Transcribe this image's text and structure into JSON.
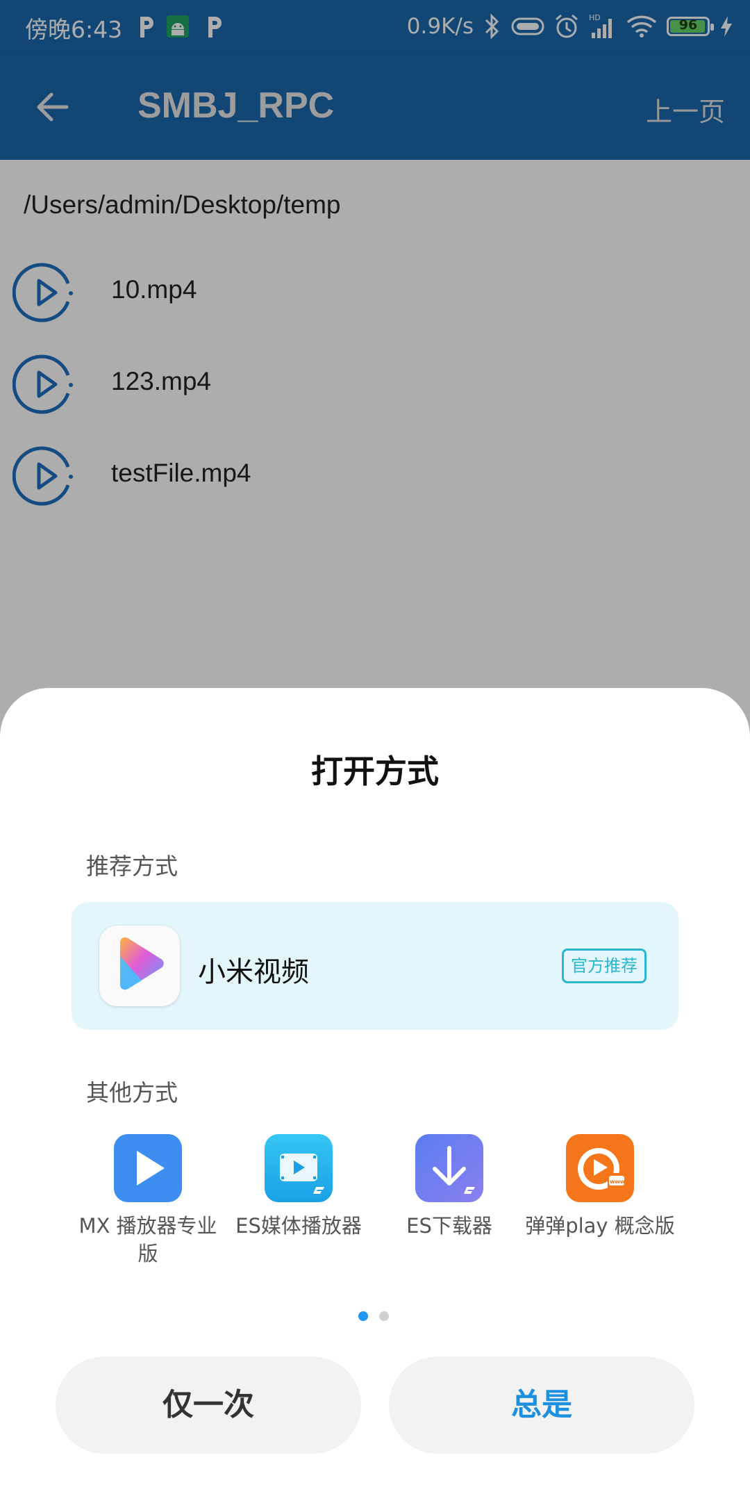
{
  "status_bar": {
    "time": "傍晚6:43",
    "net_speed": "0.9K/s",
    "signal_label": "HD",
    "battery": "96"
  },
  "app_bar": {
    "title": "SMBJ_RPC",
    "prev_page": "上一页",
    "back_icon": "arrow-left-icon"
  },
  "content": {
    "path": "/Users/admin/Desktop/temp",
    "files": [
      {
        "name": "10.mp4",
        "icon": "play-circle-icon"
      },
      {
        "name": "123.mp4",
        "icon": "play-circle-icon"
      },
      {
        "name": "testFile.mp4",
        "icon": "play-circle-icon"
      }
    ]
  },
  "sheet": {
    "title": "打开方式",
    "recommended_label": "推荐方式",
    "recommended_app": {
      "name": "小米视频",
      "badge": "官方推荐",
      "icon": "mi-video-icon"
    },
    "other_label": "其他方式",
    "other_apps": [
      {
        "name": "MX 播放器专业版",
        "icon": "mx-player-icon"
      },
      {
        "name": "ES媒体播放器",
        "icon": "es-media-player-icon"
      },
      {
        "name": "ES下载器",
        "icon": "es-downloader-icon"
      },
      {
        "name": "弹弹play 概念版",
        "icon": "dandanplay-icon"
      }
    ],
    "page_indicator": {
      "pages": 2,
      "current": 1
    },
    "buttons": {
      "once": "仅一次",
      "always": "总是"
    }
  },
  "colors": {
    "app_bar": "#1a67ad",
    "accent": "#1c8fde",
    "recommend_bg": "#e2f6fc",
    "badge": "#2ab5ce"
  }
}
